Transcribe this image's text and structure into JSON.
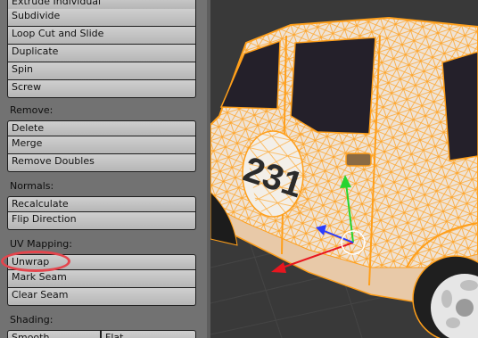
{
  "panel": {
    "add_tools": [
      {
        "label": "Extrude Individual"
      },
      {
        "label": "Subdivide"
      },
      {
        "label": "Loop Cut and Slide"
      },
      {
        "label": "Duplicate"
      },
      {
        "label": "Spin"
      },
      {
        "label": "Screw"
      }
    ],
    "remove": {
      "title": "Remove:",
      "buttons": [
        {
          "label": "Delete"
        },
        {
          "label": "Merge"
        },
        {
          "label": "Remove Doubles"
        }
      ]
    },
    "normals": {
      "title": "Normals:",
      "buttons": [
        {
          "label": "Recalculate"
        },
        {
          "label": "Flip Direction"
        }
      ]
    },
    "uv_mapping": {
      "title": "UV Mapping:",
      "buttons": [
        {
          "label": "Unwrap"
        },
        {
          "label": "Mark Seam"
        },
        {
          "label": "Clear Seam"
        }
      ]
    },
    "shading": {
      "title": "Shading:",
      "buttons": [
        {
          "label": "Smooth"
        },
        {
          "label": "Flat"
        }
      ]
    }
  },
  "viewport": {
    "car_number": "231"
  },
  "colors": {
    "panel_bg": "#727272",
    "viewport_bg": "#393939",
    "wire_selected": "#ff9f1a",
    "highlight": "#e4454d",
    "axis_x": "#e8161f",
    "axis_y": "#27d42e",
    "axis_z": "#2a3cff"
  }
}
